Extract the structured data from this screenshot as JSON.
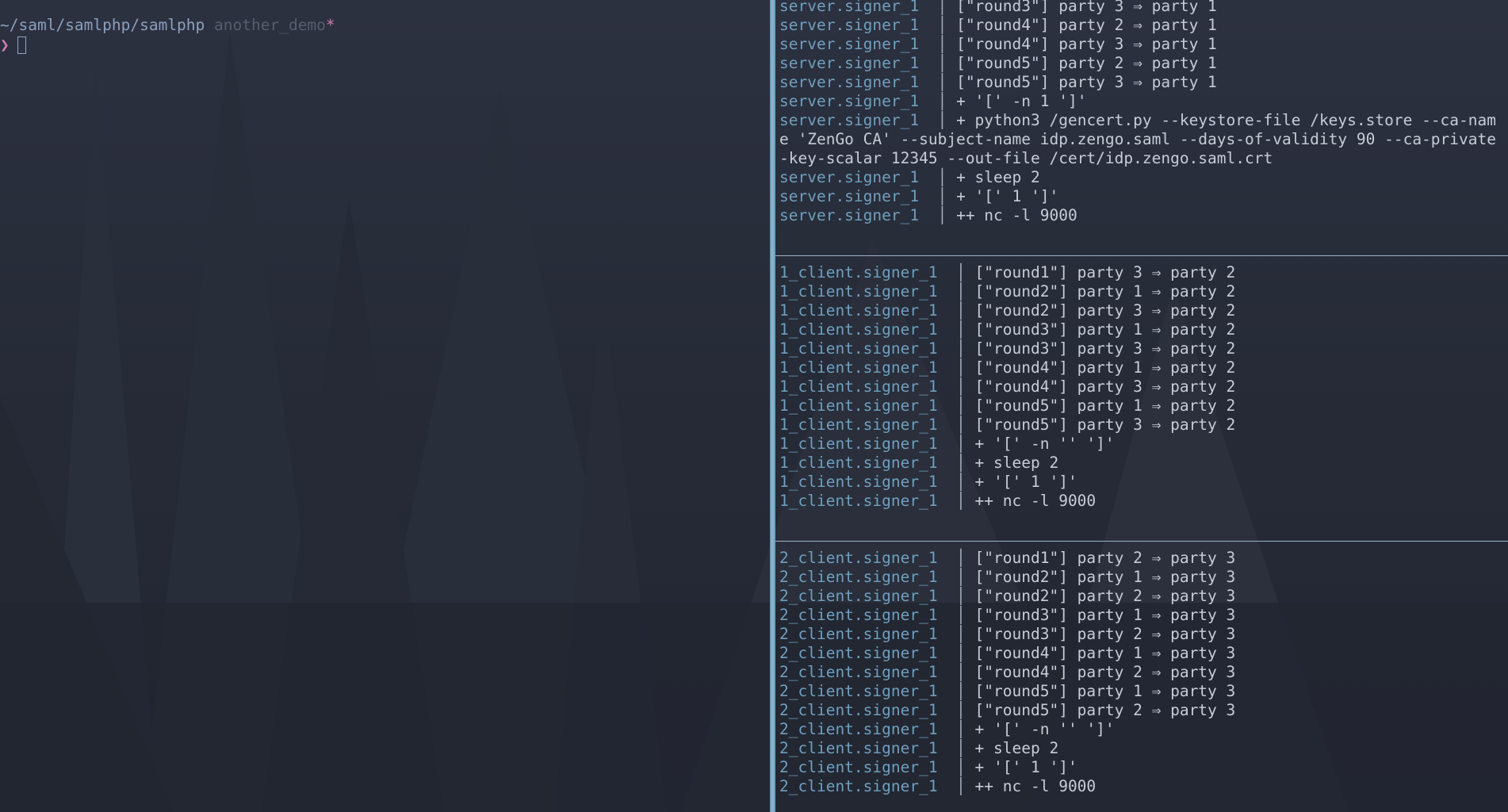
{
  "left_terminal": {
    "path": "~/saml/samlphp/samlphp",
    "branch": "another_demo",
    "dirty_marker": "*",
    "prompt_symbol": "❯"
  },
  "panes": [
    {
      "name": "server",
      "lines": [
        {
          "service": "server.signer_1  ",
          "message": "[\"round3\"] party 3 ⇒ party 1"
        },
        {
          "service": "server.signer_1  ",
          "message": "[\"round4\"] party 2 ⇒ party 1"
        },
        {
          "service": "server.signer_1  ",
          "message": "[\"round4\"] party 3 ⇒ party 1"
        },
        {
          "service": "server.signer_1  ",
          "message": "[\"round5\"] party 2 ⇒ party 1"
        },
        {
          "service": "server.signer_1  ",
          "message": "[\"round5\"] party 3 ⇒ party 1"
        },
        {
          "service": "server.signer_1  ",
          "message": "+ '[' -n 1 ']'"
        },
        {
          "service": "server.signer_1  ",
          "message": "+ python3 /gencert.py --keystore-file /keys.store --ca-nam"
        },
        {
          "continuation": "e 'ZenGo CA' --subject-name idp.zengo.saml --days-of-validity 90 --ca-private"
        },
        {
          "continuation": "-key-scalar 12345 --out-file /cert/idp.zengo.saml.crt"
        },
        {
          "service": "server.signer_1  ",
          "message": "+ sleep 2"
        },
        {
          "service": "server.signer_1  ",
          "message": "+ '[' 1 ']'"
        },
        {
          "service": "server.signer_1  ",
          "message": "++ nc -l 9000"
        }
      ]
    },
    {
      "name": "client1",
      "lines": [
        {
          "service": "1_client.signer_1  ",
          "message": "[\"round1\"] party 3 ⇒ party 2"
        },
        {
          "service": "1_client.signer_1  ",
          "message": "[\"round2\"] party 1 ⇒ party 2"
        },
        {
          "service": "1_client.signer_1  ",
          "message": "[\"round2\"] party 3 ⇒ party 2"
        },
        {
          "service": "1_client.signer_1  ",
          "message": "[\"round3\"] party 1 ⇒ party 2"
        },
        {
          "service": "1_client.signer_1  ",
          "message": "[\"round3\"] party 3 ⇒ party 2"
        },
        {
          "service": "1_client.signer_1  ",
          "message": "[\"round4\"] party 1 ⇒ party 2"
        },
        {
          "service": "1_client.signer_1  ",
          "message": "[\"round4\"] party 3 ⇒ party 2"
        },
        {
          "service": "1_client.signer_1  ",
          "message": "[\"round5\"] party 1 ⇒ party 2"
        },
        {
          "service": "1_client.signer_1  ",
          "message": "[\"round5\"] party 3 ⇒ party 2"
        },
        {
          "service": "1_client.signer_1  ",
          "message": "+ '[' -n '' ']'"
        },
        {
          "service": "1_client.signer_1  ",
          "message": "+ sleep 2"
        },
        {
          "service": "1_client.signer_1  ",
          "message": "+ '[' 1 ']'"
        },
        {
          "service": "1_client.signer_1  ",
          "message": "++ nc -l 9000"
        }
      ]
    },
    {
      "name": "client2",
      "lines": [
        {
          "service": "2_client.signer_1  ",
          "message": "[\"round1\"] party 2 ⇒ party 3"
        },
        {
          "service": "2_client.signer_1  ",
          "message": "[\"round2\"] party 1 ⇒ party 3"
        },
        {
          "service": "2_client.signer_1  ",
          "message": "[\"round2\"] party 2 ⇒ party 3"
        },
        {
          "service": "2_client.signer_1  ",
          "message": "[\"round3\"] party 1 ⇒ party 3"
        },
        {
          "service": "2_client.signer_1  ",
          "message": "[\"round3\"] party 2 ⇒ party 3"
        },
        {
          "service": "2_client.signer_1  ",
          "message": "[\"round4\"] party 1 ⇒ party 3"
        },
        {
          "service": "2_client.signer_1  ",
          "message": "[\"round4\"] party 2 ⇒ party 3"
        },
        {
          "service": "2_client.signer_1  ",
          "message": "[\"round5\"] party 1 ⇒ party 3"
        },
        {
          "service": "2_client.signer_1  ",
          "message": "[\"round5\"] party 2 ⇒ party 3"
        },
        {
          "service": "2_client.signer_1  ",
          "message": "+ '[' -n '' ']'"
        },
        {
          "service": "2_client.signer_1  ",
          "message": "+ sleep 2"
        },
        {
          "service": "2_client.signer_1  ",
          "message": "+ '[' 1 ']'"
        },
        {
          "service": "2_client.signer_1  ",
          "message": "++ nc -l 9000"
        }
      ]
    }
  ],
  "separator": "│ ",
  "colors": {
    "service": "#6f9fbe",
    "path": "#8aa0be",
    "branch": "#565d6e",
    "dirty": "#d07bb2",
    "divider": "#8db9d3"
  }
}
